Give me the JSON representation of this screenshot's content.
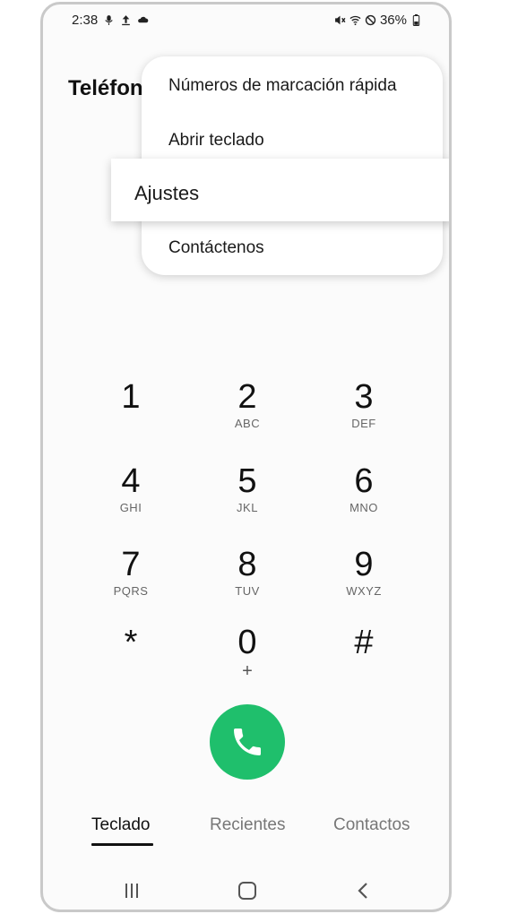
{
  "status_bar": {
    "time": "2:38",
    "battery": "36%",
    "icons_left": [
      "microphone-icon",
      "upload-icon",
      "cloud-icon"
    ],
    "icons_right": [
      "mute-icon",
      "wifi-icon",
      "do-not-disturb-icon",
      "battery-icon"
    ]
  },
  "header": {
    "title": "Teléfono"
  },
  "menu": {
    "items": [
      {
        "label": "Números de marcación rápida"
      },
      {
        "label": "Abrir teclado"
      },
      {
        "label": "Ajustes",
        "highlighted": true
      },
      {
        "label": "Contáctenos"
      }
    ]
  },
  "keypad": {
    "keys": [
      {
        "digit": "1",
        "letters": ""
      },
      {
        "digit": "2",
        "letters": "ABC"
      },
      {
        "digit": "3",
        "letters": "DEF"
      },
      {
        "digit": "4",
        "letters": "GHI"
      },
      {
        "digit": "5",
        "letters": "JKL"
      },
      {
        "digit": "6",
        "letters": "MNO"
      },
      {
        "digit": "7",
        "letters": "PQRS"
      },
      {
        "digit": "8",
        "letters": "TUV"
      },
      {
        "digit": "9",
        "letters": "WXYZ"
      },
      {
        "digit": "*",
        "letters": ""
      },
      {
        "digit": "0",
        "letters": "+"
      },
      {
        "digit": "#",
        "letters": ""
      }
    ]
  },
  "call_button": {
    "icon": "phone-icon",
    "color": "#1fbf6c"
  },
  "tabs": {
    "items": [
      {
        "label": "Teclado",
        "active": true
      },
      {
        "label": "Recientes"
      },
      {
        "label": "Contactos"
      }
    ]
  },
  "nav_bar": {
    "icons": [
      "recent-apps-icon",
      "home-icon",
      "back-icon"
    ]
  }
}
